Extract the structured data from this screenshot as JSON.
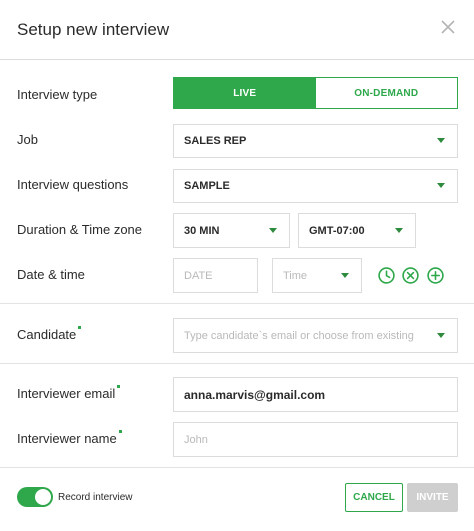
{
  "dialog": {
    "title": "Setup new interview"
  },
  "colors": {
    "accent": "#2ea84b",
    "disabled": "#cfcfcf",
    "border": "#dcdcdc"
  },
  "interview_type": {
    "label": "Interview type",
    "options": [
      "LIVE",
      "ON-DEMAND"
    ],
    "selected": "LIVE"
  },
  "job": {
    "label": "Job",
    "value": "SALES REP"
  },
  "questions": {
    "label": "Interview questions",
    "value": "SAMPLE"
  },
  "duration": {
    "label": "Duration & Time zone",
    "value": "30 MIN",
    "timezone": "GMT-07:00"
  },
  "datetime": {
    "label": "Date & time",
    "date_placeholder": "DATE",
    "time_placeholder": "Time"
  },
  "candidate": {
    "label": "Candidate",
    "placeholder": "Type candidate`s email or choose from existing"
  },
  "interviewer_email": {
    "label": "Interviewer email",
    "value": "anna.marvis@gmail.com"
  },
  "interviewer_name": {
    "label": "Interviewer name",
    "placeholder": "John"
  },
  "footer": {
    "record_label": "Record interview",
    "record_on": true,
    "cancel_label": "CANCEL",
    "invite_label": "INVITE"
  }
}
